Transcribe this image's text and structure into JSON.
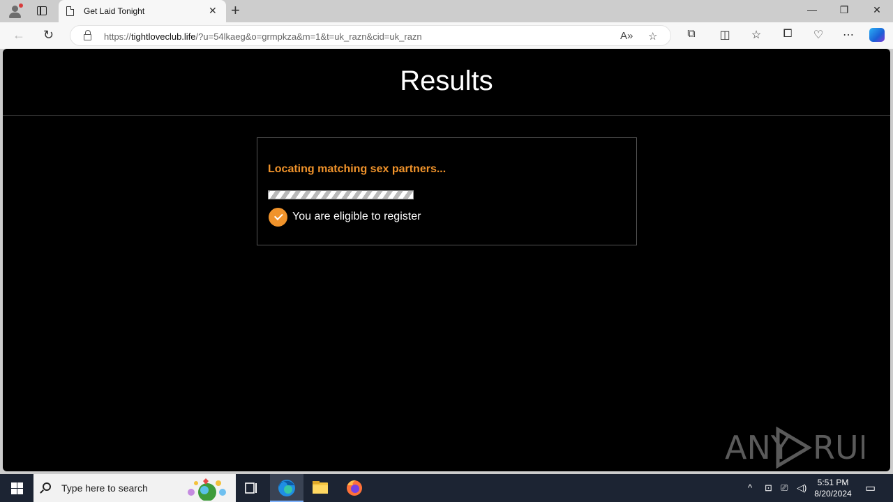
{
  "browser": {
    "tab_title": "Get Laid Tonight",
    "url_prefix": "https://",
    "url_host": "tightloveclub.life",
    "url_path": "/?u=54lkaeg&o=grmpkza&m=1&t=uk_razn&cid=uk_razn"
  },
  "page": {
    "title": "Results",
    "status_text": "Locating matching sex partners...",
    "progress_fraction": 1.0,
    "eligible_text": "You are eligible to register",
    "accent_color": "#f0932b",
    "watermark": "ANY RUN"
  },
  "taskbar": {
    "search_placeholder": "Type here to search",
    "time": "5:51 PM",
    "date": "8/20/2024",
    "apps": [
      "task-view",
      "edge",
      "file-explorer",
      "firefox"
    ]
  }
}
